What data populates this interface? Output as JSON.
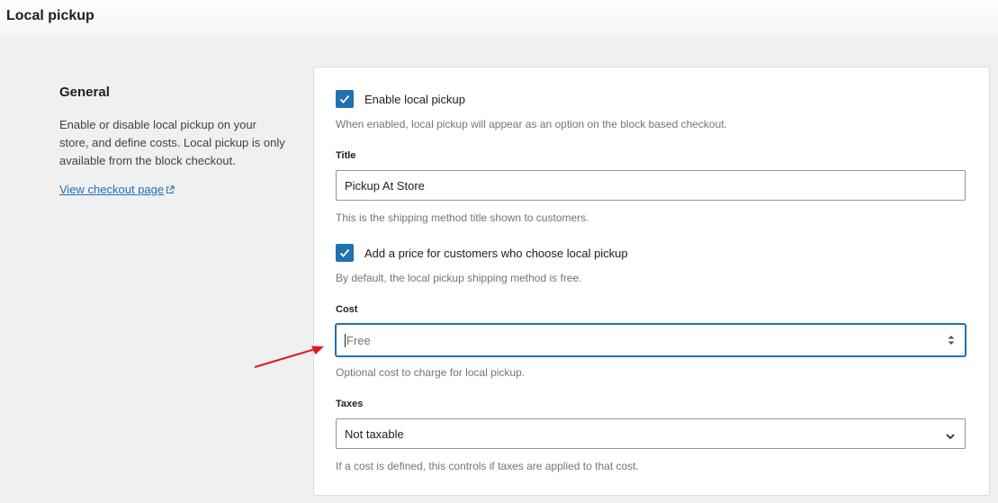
{
  "page": {
    "title": "Local pickup"
  },
  "sidebar": {
    "heading": "General",
    "description": "Enable or disable local pickup on your store, and define costs. Local pickup is only available from the block checkout.",
    "link_label": "View checkout page",
    "link_icon": "external-link-icon"
  },
  "form": {
    "enable": {
      "checked": true,
      "label": "Enable local pickup",
      "help": "When enabled, local pickup will appear as an option on the block based checkout."
    },
    "title": {
      "label": "Title",
      "value": "Pickup At Store",
      "help": "This is the shipping method title shown to customers."
    },
    "add_price": {
      "checked": true,
      "label": "Add a price for customers who choose local pickup",
      "help": "By default, the local pickup shipping method is free."
    },
    "cost": {
      "label": "Cost",
      "value": "",
      "placeholder": "Free",
      "help": "Optional cost to charge for local pickup."
    },
    "taxes": {
      "label": "Taxes",
      "selected": "Not taxable",
      "help": "If a cost is defined, this controls if taxes are applied to that cost."
    }
  },
  "colors": {
    "accent": "#2271b1",
    "annotation_arrow": "#e31b1b"
  }
}
